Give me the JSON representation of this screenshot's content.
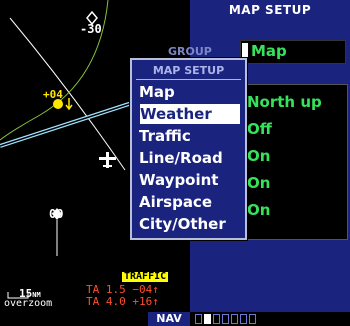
{
  "map": {
    "range": "15",
    "range_unit": "NM",
    "overzoom": "overzoom",
    "altitude_top": "-30",
    "altitude_bottom": "00",
    "traffic_relative_alt": "+04",
    "traffic_label": "TRAFFIC",
    "ta_line1": "TA 1.5 −04↑",
    "ta_line2": "TA 4.0 +16↑"
  },
  "panel": {
    "title": "MAP SETUP",
    "group_label": "GROUP",
    "group_value": "Map",
    "settings": [
      "North up",
      "Off",
      "On",
      "On",
      "On"
    ]
  },
  "popup": {
    "title": "MAP SETUP",
    "items": [
      "Map",
      "Weather",
      "Traffic",
      "Line/Road",
      "Waypoint",
      "Airspace",
      "City/Other"
    ],
    "selected": "Weather"
  },
  "status": {
    "nav_label": "NAV",
    "page_count": 7,
    "active_page": 1
  },
  "colors": {
    "panel_blue": "#1a237e",
    "value_green": "#35e35a",
    "traffic_yellow": "#ffff00",
    "ta_orange": "#ff4d2e"
  }
}
